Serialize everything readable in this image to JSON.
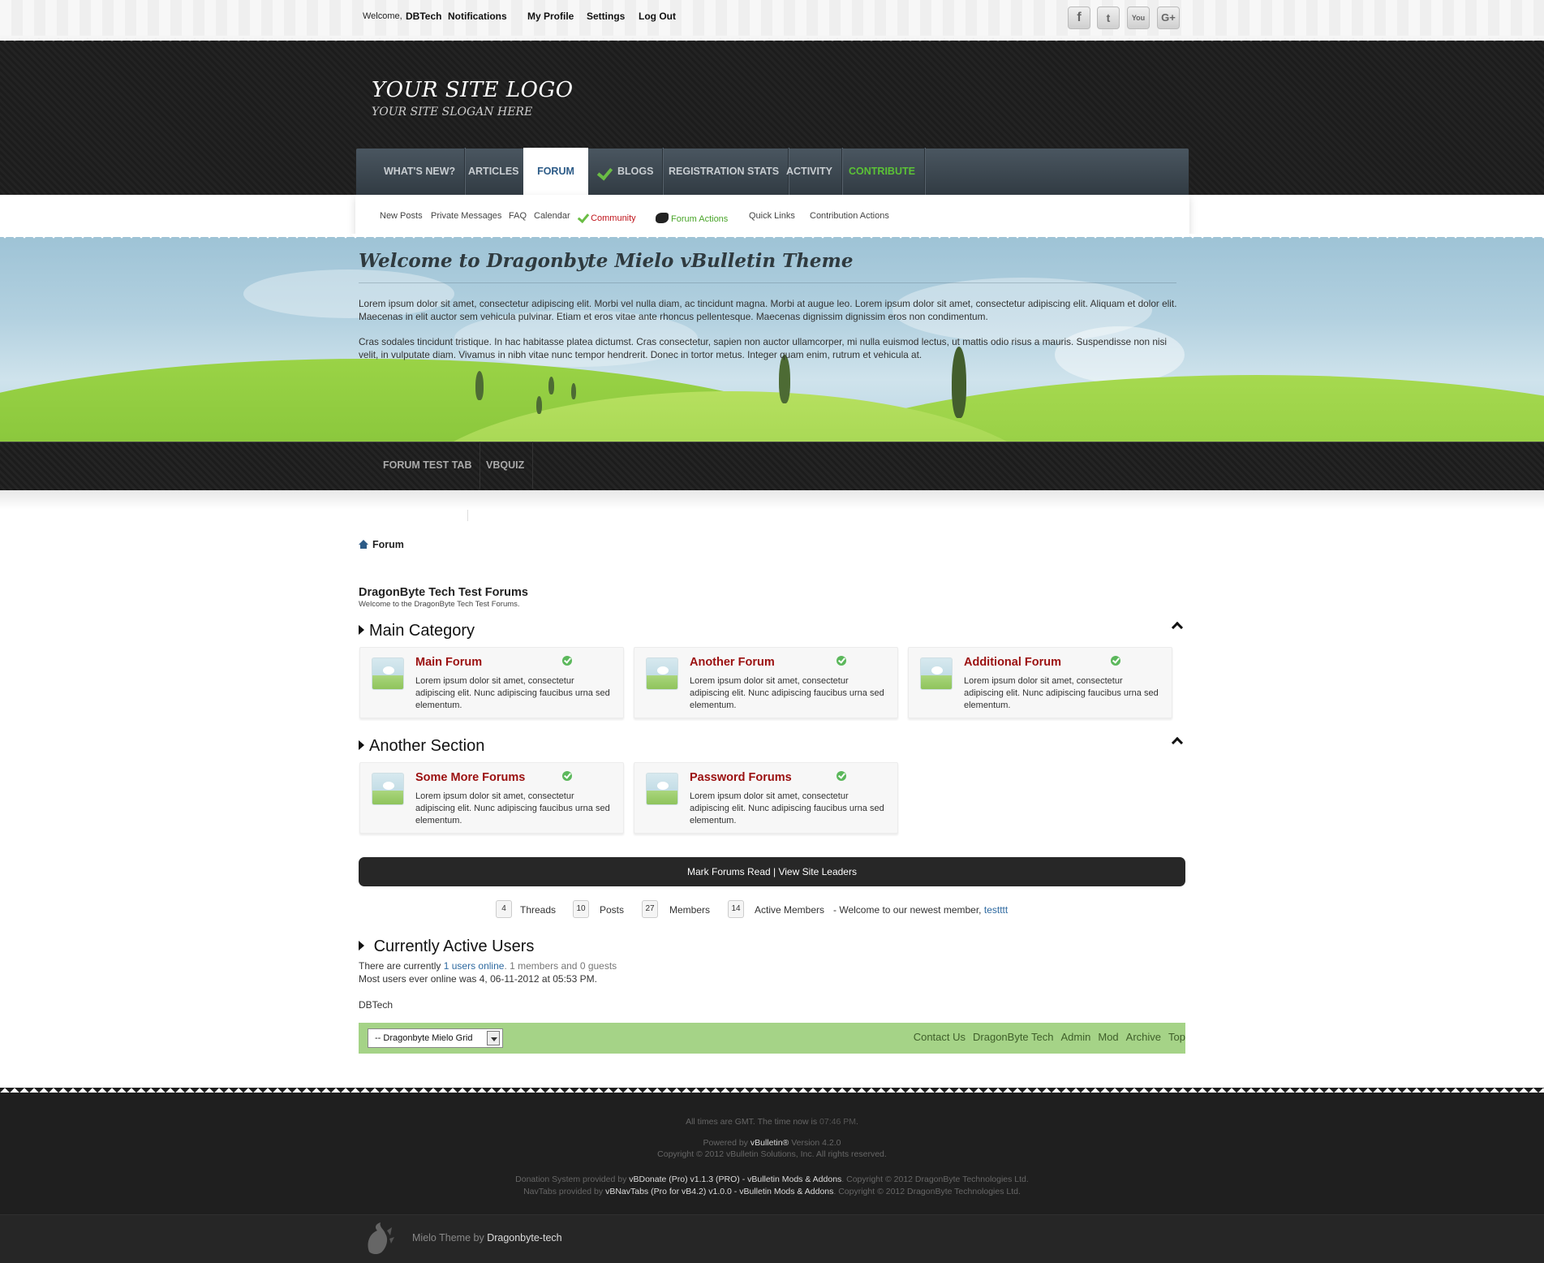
{
  "topbar": {
    "welcome": "Welcome,",
    "username": "DBTech",
    "links": [
      "Notifications",
      "My Profile",
      "Settings",
      "Log Out"
    ],
    "social": [
      "facebook",
      "twitter",
      "youtube",
      "google-plus"
    ]
  },
  "header": {
    "logo": "YOUR SITE LOGO",
    "slogan": "YOUR SITE SLOGAN HERE"
  },
  "mainnav": {
    "tabs": [
      "WHAT'S NEW?",
      "ARTICLES",
      "FORUM",
      "BLOGS",
      "REGISTRATION STATS",
      "ACTIVITY",
      "CONTRIBUTE"
    ],
    "active": "FORUM"
  },
  "subnav": {
    "links": [
      "New Posts",
      "Private Messages",
      "FAQ",
      "Calendar",
      "Community",
      "Forum Actions",
      "Quick Links",
      "Contribution Actions"
    ]
  },
  "banner": {
    "title": "Welcome to Dragonbyte Mielo vBulletin Theme",
    "para1": "Lorem ipsum dolor sit amet, consectetur adipiscing elit. Morbi vel nulla diam, ac tincidunt magna. Morbi at augue leo. Lorem ipsum dolor sit amet, consectetur adipiscing elit. Aliquam et dolor elit. Maecenas in elit auctor sem vehicula pulvinar. Etiam et eros vitae ante rhoncus pellentesque. Maecenas dignissim dignissim eros non condimentum.",
    "para2": "Cras sodales tincidunt tristique. In hac habitasse platea dictumst. Cras consectetur, sapien non auctor ullamcorper, mi nulla euismod lectus, ut mattis odio risus a mauris. Suspendisse non nisi velit, in vulputate diam. Vivamus in nibh vitae nunc tempor hendrerit. Donec in tortor metus. Integer quam enim, rutrum et vehicula at."
  },
  "secnav": {
    "tabs": [
      "FORUM TEST TAB",
      "VBQUIZ"
    ]
  },
  "breadcrumb": "Forum",
  "forum": {
    "title": "DragonByte Tech Test Forums",
    "subtitle": "Welcome to the DragonByte Tech Test Forums."
  },
  "categories": [
    {
      "name": "Main Category",
      "forums": [
        {
          "title": "Main Forum",
          "desc": "Lorem ipsum dolor sit amet, consectetur adipiscing elit. Nunc adipiscing faucibus urna sed elementum."
        },
        {
          "title": "Another Forum",
          "desc": "Lorem ipsum dolor sit amet, consectetur adipiscing elit. Nunc adipiscing faucibus urna sed elementum."
        },
        {
          "title": "Additional Forum",
          "desc": "Lorem ipsum dolor sit amet, consectetur adipiscing elit. Nunc adipiscing faucibus urna sed elementum."
        }
      ]
    },
    {
      "name": "Another Section",
      "forums": [
        {
          "title": "Some More Forums",
          "desc": "Lorem ipsum dolor sit amet, consectetur adipiscing elit. Nunc adipiscing faucibus urna sed elementum."
        },
        {
          "title": "Password Forums",
          "desc": "Lorem ipsum dolor sit amet, consectetur adipiscing elit. Nunc adipiscing faucibus urna sed elementum."
        }
      ]
    }
  ],
  "actionbar": "Mark Forums Read | View Site Leaders",
  "stats": {
    "threads": {
      "value": "4",
      "label": "Threads"
    },
    "posts": {
      "value": "10",
      "label": "Posts"
    },
    "members": {
      "value": "27",
      "label": "Members"
    },
    "active": {
      "value": "14",
      "label": "Active Members"
    },
    "newest_prefix": "- Welcome to our newest member,",
    "newest_member": "testttt"
  },
  "active_users": {
    "title": "Currently Active Users",
    "line1_prefix": "There are currently",
    "line1_link": "1 users online",
    "line1_suffix": ". 1 members and 0 guests",
    "line2": "Most users ever online was 4, 06-11-2012 at 05:53 PM.",
    "user": "DBTech"
  },
  "footerbar": {
    "style_select": "-- Dragonbyte Mielo Grid",
    "links": [
      "Contact Us",
      "DragonByte Tech",
      "Admin",
      "Mod",
      "Archive",
      "Top"
    ]
  },
  "footer": {
    "time_prefix": "All times are GMT. The time now is",
    "time": "07:46 PM",
    "powered_prefix": "Powered by",
    "powered_name": "vBulletin®",
    "powered_version": "Version 4.2.0",
    "copyright": "Copyright © 2012 vBulletin Solutions, Inc. All rights reserved.",
    "donation_prefix": "Donation System provided by",
    "donation_link": "vBDonate (Pro) v1.1.3 (PRO) - vBulletin Mods & Addons",
    "donation_suffix": "Copyright © 2012 DragonByte Technologies Ltd.",
    "navtabs_prefix": "NavTabs provided by",
    "navtabs_link": "vBNavTabs (Pro for vB4.2) v1.0.0 - vBulletin Mods & Addons",
    "navtabs_suffix": "Copyright © 2012 DragonByte Technologies Ltd.",
    "theme_prefix": "Mielo Theme by",
    "theme_author": "Dragonbyte-tech"
  }
}
